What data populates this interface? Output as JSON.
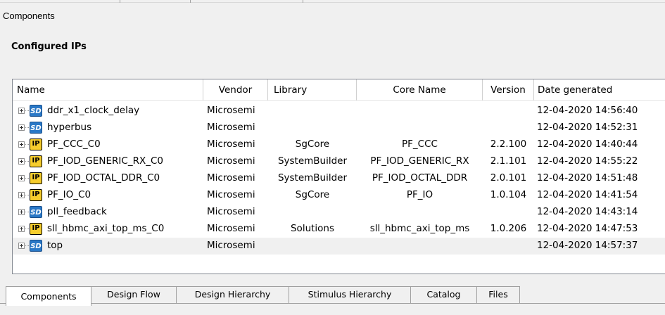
{
  "panel": {
    "title": "Components"
  },
  "section": {
    "title": "Configured IPs"
  },
  "table": {
    "columns": [
      "Name",
      "Vendor",
      "Library",
      "Core Name",
      "Version",
      "Date generated"
    ],
    "rows": [
      {
        "icon": "sd-icon",
        "badge": "SD",
        "name": "ddr_x1_clock_delay",
        "vendor": "Microsemi",
        "library": "",
        "core": "",
        "version": "",
        "date": "12-04-2020 14:56:40"
      },
      {
        "icon": "sd-icon",
        "badge": "SD",
        "name": "hyperbus",
        "vendor": "Microsemi",
        "library": "",
        "core": "",
        "version": "",
        "date": "12-04-2020 14:52:31"
      },
      {
        "icon": "ip-icon",
        "badge": "IP",
        "name": "PF_CCC_C0",
        "vendor": "Microsemi",
        "library": "SgCore",
        "core": "PF_CCC",
        "version": "2.2.100",
        "date": "12-04-2020 14:40:44"
      },
      {
        "icon": "ip-icon",
        "badge": "IP",
        "name": "PF_IOD_GENERIC_RX_C0",
        "vendor": "Microsemi",
        "library": "SystemBuilder",
        "core": "PF_IOD_GENERIC_RX",
        "version": "2.1.101",
        "date": "12-04-2020 14:55:22"
      },
      {
        "icon": "ip-icon",
        "badge": "IP",
        "name": "PF_IOD_OCTAL_DDR_C0",
        "vendor": "Microsemi",
        "library": "SystemBuilder",
        "core": "PF_IOD_OCTAL_DDR",
        "version": "2.0.101",
        "date": "12-04-2020 14:51:48"
      },
      {
        "icon": "ip-icon",
        "badge": "IP",
        "name": "PF_IO_C0",
        "vendor": "Microsemi",
        "library": "SgCore",
        "core": "PF_IO",
        "version": "1.0.104",
        "date": "12-04-2020 14:41:54"
      },
      {
        "icon": "sd-icon",
        "badge": "SD",
        "name": "pll_feedback",
        "vendor": "Microsemi",
        "library": "",
        "core": "",
        "version": "",
        "date": "12-04-2020 14:43:14"
      },
      {
        "icon": "ip-icon",
        "badge": "IP",
        "name": "sll_hbmc_axi_top_ms_C0",
        "vendor": "Microsemi",
        "library": "Solutions",
        "core": "sll_hbmc_axi_top_ms",
        "version": "1.0.206",
        "date": "12-04-2020 14:47:53"
      },
      {
        "icon": "sd-icon",
        "badge": "SD",
        "name": "top",
        "vendor": "Microsemi",
        "library": "",
        "core": "",
        "version": "",
        "date": "12-04-2020 14:57:37",
        "selected": true
      }
    ]
  },
  "tabs": {
    "items": [
      "Components",
      "Design Flow",
      "Design Hierarchy",
      "Stimulus Hierarchy",
      "Catalog",
      "Files"
    ],
    "active": "Components"
  }
}
